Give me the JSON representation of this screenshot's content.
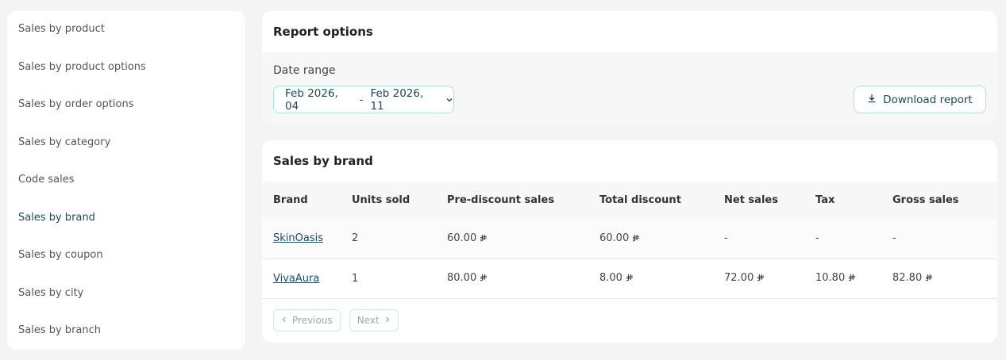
{
  "sidebar": {
    "items": [
      {
        "label": "Sales by product"
      },
      {
        "label": "Sales by product options"
      },
      {
        "label": "Sales by order options"
      },
      {
        "label": "Sales by category"
      },
      {
        "label": "Code sales"
      },
      {
        "label": "Sales by brand",
        "active": true
      },
      {
        "label": "Sales by coupon"
      },
      {
        "label": "Sales by city"
      },
      {
        "label": "Sales by branch"
      }
    ]
  },
  "report_options": {
    "title": "Report options",
    "date_label": "Date range",
    "date_from": "Feb 2026, 04",
    "date_sep": "-",
    "date_to": "Feb 2026, 11",
    "download_label": "Download report"
  },
  "sales_by_brand": {
    "title": "Sales by brand",
    "columns": [
      "Brand",
      "Units sold",
      "Pre-discount sales",
      "Total discount",
      "Net sales",
      "Tax",
      "Gross sales"
    ],
    "rows": [
      {
        "brand": "SkinOasis",
        "units": "2",
        "pre": "60.00",
        "discount": "60.00",
        "net": "-",
        "tax": "-",
        "gross": "-"
      },
      {
        "brand": "VivaAura",
        "units": "1",
        "pre": "80.00",
        "discount": "8.00",
        "net": "72.00",
        "tax": "10.80",
        "gross": "82.80"
      }
    ],
    "pager": {
      "previous": "Previous",
      "next": "Next"
    }
  },
  "colors": {
    "accent": "#1a4b5c",
    "border_accent": "#a6e3dc"
  },
  "icons": {
    "currency": "riyal-icon",
    "download": "download-icon",
    "chevron": "chevron-down-icon"
  }
}
